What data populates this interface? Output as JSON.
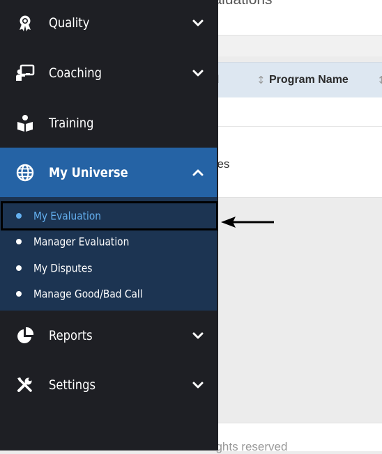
{
  "page": {
    "title": "valuations",
    "table": {
      "columns": [
        "ld",
        "Program Name"
      ]
    },
    "entries_text": "ries",
    "footer_text": "rights reserved"
  },
  "sidebar": {
    "items": [
      {
        "label": "Quality",
        "icon": "award-icon",
        "expandable": true,
        "expanded": false
      },
      {
        "label": "Coaching",
        "icon": "chalkboard-teacher-icon",
        "expandable": true,
        "expanded": false
      },
      {
        "label": "Training",
        "icon": "book-reader-icon",
        "expandable": false
      },
      {
        "label": "My Universe",
        "icon": "globe-icon",
        "expandable": true,
        "expanded": true,
        "active": true
      },
      {
        "label": "Reports",
        "icon": "pie-chart-icon",
        "expandable": true,
        "expanded": false
      },
      {
        "label": "Settings",
        "icon": "tools-icon",
        "expandable": true,
        "expanded": false
      }
    ],
    "submenu": [
      {
        "label": "My Evaluation",
        "current": true
      },
      {
        "label": "Manager Evaluation"
      },
      {
        "label": "My Disputes"
      },
      {
        "label": "Manage Good/Bad Call"
      }
    ]
  },
  "colors": {
    "sidebar_bg": "#1e1f24",
    "active_bg": "#2563a5",
    "submenu_bg": "#1c3452",
    "current_text": "#64b0f0",
    "table_header_bg": "#dde7f1"
  }
}
